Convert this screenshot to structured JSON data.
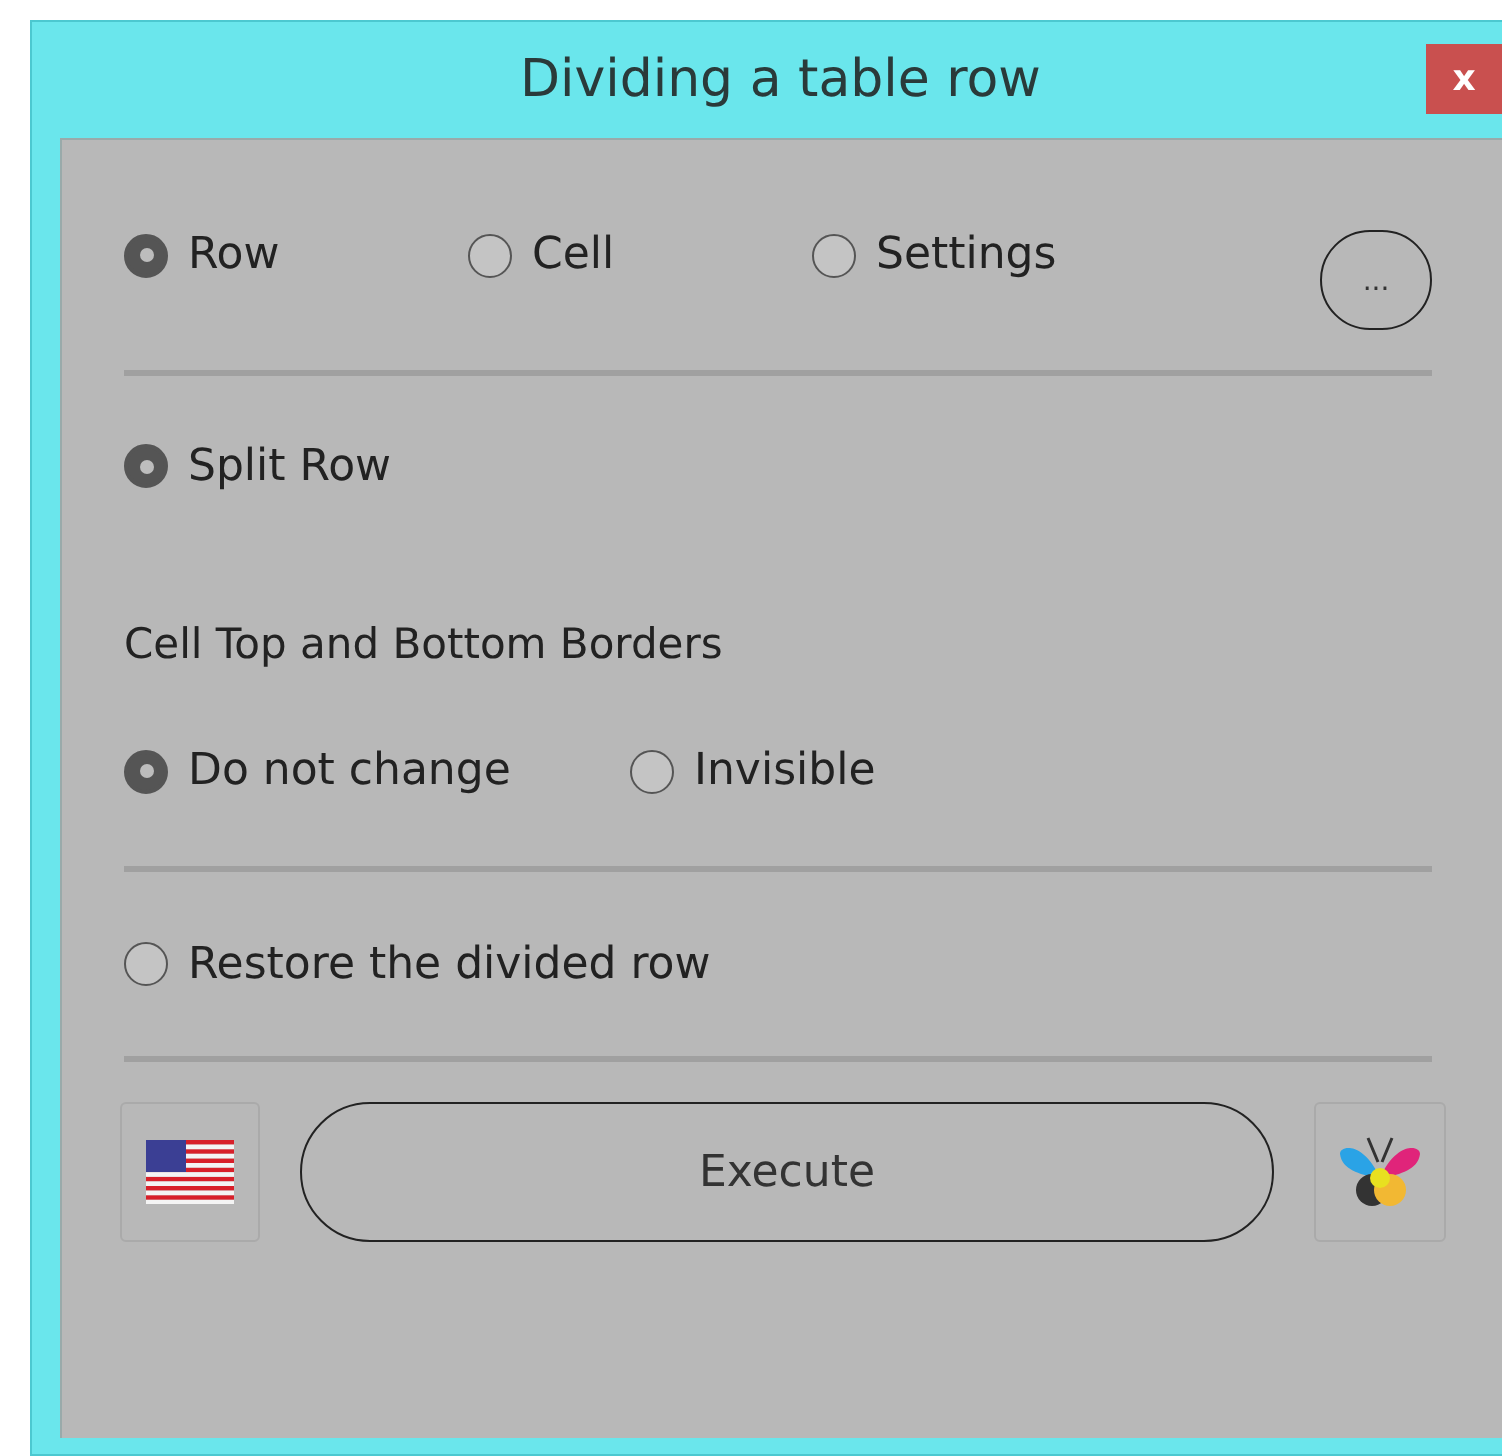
{
  "window": {
    "title": "Dividing a table row",
    "close_button": "x"
  },
  "mode_options": [
    {
      "label": "Row",
      "selected": true
    },
    {
      "label": "Cell",
      "selected": false
    },
    {
      "label": "Settings",
      "selected": false
    }
  ],
  "more_button": "...",
  "split_row": {
    "label": "Split Row",
    "selected": true
  },
  "borders_label": "Cell Top and Bottom Borders",
  "border_options": [
    {
      "label": "Do not change",
      "selected": true
    },
    {
      "label": "Invisible",
      "selected": false
    }
  ],
  "restore": {
    "label": "Restore the divided row",
    "selected": false
  },
  "execute_button": "Execute"
}
